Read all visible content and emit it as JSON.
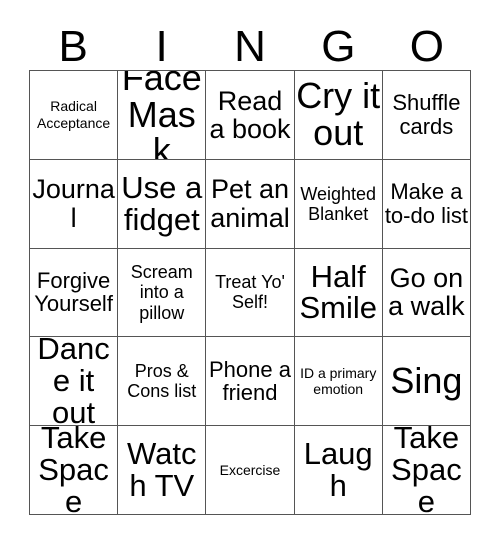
{
  "card": {
    "title": "BINGO",
    "header_letters": [
      "B",
      "I",
      "N",
      "G",
      "O"
    ],
    "columns": 5,
    "rows": 5,
    "colors": {
      "background": "#ffffff",
      "text": "#000000",
      "grid_line": "#555555"
    },
    "cells": [
      {
        "text": "Radical Acceptance",
        "size": "fs-xs"
      },
      {
        "text": "Face Mask",
        "size": "fs-xxl"
      },
      {
        "text": "Read a book",
        "size": "fs-l"
      },
      {
        "text": "Cry it out",
        "size": "fs-xxl"
      },
      {
        "text": "Shuffle cards",
        "size": "fs-m"
      },
      {
        "text": "Journal",
        "size": "fs-l"
      },
      {
        "text": "Use a fidget",
        "size": "fs-xl"
      },
      {
        "text": "Pet an animal",
        "size": "fs-l"
      },
      {
        "text": "Weighted Blanket",
        "size": "fs-s"
      },
      {
        "text": "Make a to-do list",
        "size": "fs-m"
      },
      {
        "text": "Forgive Yourself",
        "size": "fs-m"
      },
      {
        "text": "Scream into a pillow",
        "size": "fs-s"
      },
      {
        "text": "Treat Yo' Self!",
        "size": "fs-s"
      },
      {
        "text": "Half Smile",
        "size": "fs-xl"
      },
      {
        "text": "Go on a walk",
        "size": "fs-l"
      },
      {
        "text": "Dance it out",
        "size": "fs-xl"
      },
      {
        "text": "Pros & Cons list",
        "size": "fs-s"
      },
      {
        "text": "Phone a friend",
        "size": "fs-m"
      },
      {
        "text": "ID a primary emotion",
        "size": "fs-xs"
      },
      {
        "text": "Sing",
        "size": "fs-xxl"
      },
      {
        "text": "Take Space",
        "size": "fs-xl"
      },
      {
        "text": "Watch TV",
        "size": "fs-xl"
      },
      {
        "text": "Excercise",
        "size": "fs-xs"
      },
      {
        "text": "Laugh",
        "size": "fs-xl"
      },
      {
        "text": "Take Space",
        "size": "fs-xl"
      }
    ]
  }
}
